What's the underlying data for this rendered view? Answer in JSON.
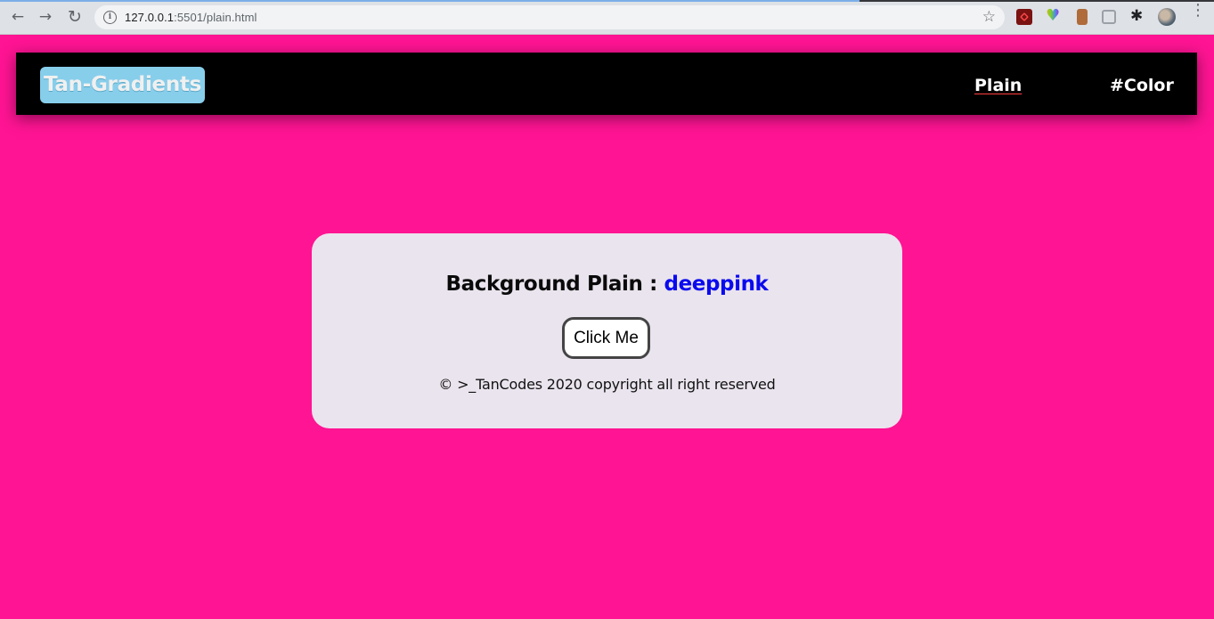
{
  "browser": {
    "url_host": "127.0.0.1",
    "url_rest": ":5501/plain.html",
    "back_glyph": "←",
    "forward_glyph": "→",
    "reload_glyph": "↻",
    "info_glyph": "i",
    "star_glyph": "☆",
    "puzzle_glyph": "✱",
    "menu_glyph": "⋮",
    "extension_icons": [
      "pdf-extension-icon",
      "color-heart-extension-icon",
      "door-extension-icon",
      "tower-extension-icon",
      "puzzle-icon"
    ]
  },
  "page": {
    "background_color": "#ff1493",
    "navbar": {
      "brand": "Tan-Gradients",
      "links": [
        {
          "label": "Plain"
        },
        {
          "label": "#Color"
        }
      ]
    },
    "card": {
      "title_prefix": "Background Plain : ",
      "color_name": "deeppink",
      "button_label": "Click Me",
      "footer": "© >_TanCodes 2020 copyright all right reserved"
    }
  }
}
